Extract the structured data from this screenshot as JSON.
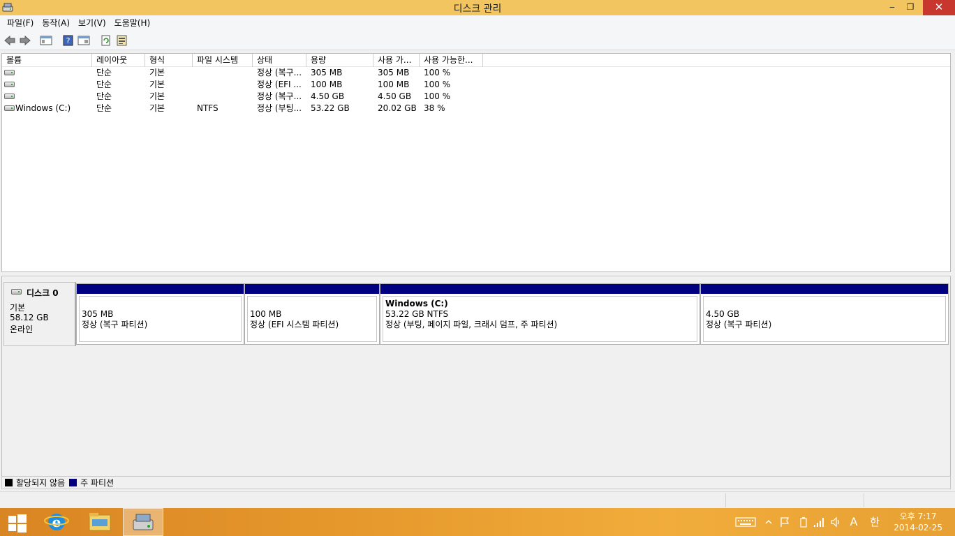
{
  "window": {
    "title": "디스크 관리",
    "controls": {
      "minimize": "‒",
      "maximize": "❐",
      "close": "✕"
    }
  },
  "menu": [
    {
      "label": "파일(F)"
    },
    {
      "label": "동작(A)"
    },
    {
      "label": "보기(V)"
    },
    {
      "label": "도움말(H)"
    }
  ],
  "toolbar": {
    "icons": [
      "back-arrow-icon",
      "forward-arrow-icon",
      "console-tree-icon",
      "help-icon",
      "action-pane-icon",
      "refresh-icon",
      "properties-icon"
    ]
  },
  "volume_list": {
    "columns": [
      "볼륨",
      "레이아웃",
      "형식",
      "파일 시스템",
      "상태",
      "용량",
      "사용 가...",
      "사용 가능한..."
    ],
    "rows": [
      {
        "volume": "",
        "layout": "단순",
        "type": "기본",
        "fs": "",
        "status": "정상 (복구...",
        "capacity": "305 MB",
        "free": "305 MB",
        "free_pct": "100 %"
      },
      {
        "volume": "",
        "layout": "단순",
        "type": "기본",
        "fs": "",
        "status": "정상 (EFI ...",
        "capacity": "100 MB",
        "free": "100 MB",
        "free_pct": "100 %"
      },
      {
        "volume": "",
        "layout": "단순",
        "type": "기본",
        "fs": "",
        "status": "정상 (복구...",
        "capacity": "4.50 GB",
        "free": "4.50 GB",
        "free_pct": "100 %"
      },
      {
        "volume": "Windows (C:)",
        "layout": "단순",
        "type": "기본",
        "fs": "NTFS",
        "status": "정상 (부팅...",
        "capacity": "53.22 GB",
        "free": "20.02 GB",
        "free_pct": "38 %"
      }
    ]
  },
  "disk": {
    "name": "디스크 0",
    "type": "기본",
    "size": "58.12 GB",
    "state": "온라인",
    "partitions": [
      {
        "name": "",
        "size": "305 MB",
        "status": "정상 (복구 파티션)"
      },
      {
        "name": "",
        "size": "100 MB",
        "status": "정상 (EFI 시스템 파티션)"
      },
      {
        "name": "Windows  (C:)",
        "size": "53.22 GB NTFS",
        "status": "정상 (부팅, 페이지 파일, 크래시 덤프, 주 파티션)"
      },
      {
        "name": "",
        "size": "4.50 GB",
        "status": "정상 (복구 파티션)"
      }
    ]
  },
  "legend": [
    {
      "label": "할당되지 않음",
      "color": "#000000"
    },
    {
      "label": "주 파티션",
      "color": "#000080"
    }
  ],
  "taskbar": {
    "apps": [
      "start-icon",
      "internet-explorer-icon",
      "file-explorer-icon",
      "disk-management-icon"
    ],
    "tray": {
      "ime_mode": "A",
      "ime_lang": "한",
      "time": "오후 7:17",
      "date": "2014-02-25"
    }
  },
  "colors": {
    "title_bar": "#f3c560",
    "primary_partition": "#000080",
    "close_button": "#c7372d"
  }
}
